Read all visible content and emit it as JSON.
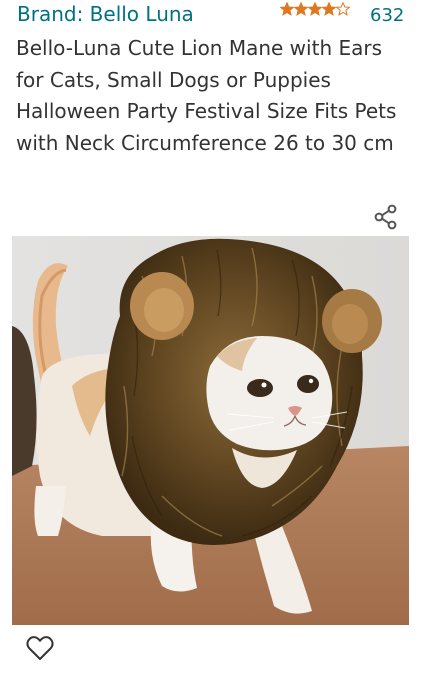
{
  "product": {
    "brand_label": "Brand: Bello Luna",
    "rating_stars": 4,
    "rating_max": 5,
    "rating_count": "632",
    "title": "Bello-Luna Cute Lion Mane with Ears for Cats, Small Dogs or Puppies Halloween Party Festival Size Fits Pets with Neck Circumference 26 to 30 cm"
  },
  "icons": {
    "share": "share-icon",
    "wishlist": "heart-outline-icon",
    "star": "star-icon"
  },
  "colors": {
    "link": "#007185",
    "text": "#333333",
    "star": "#de7921"
  }
}
